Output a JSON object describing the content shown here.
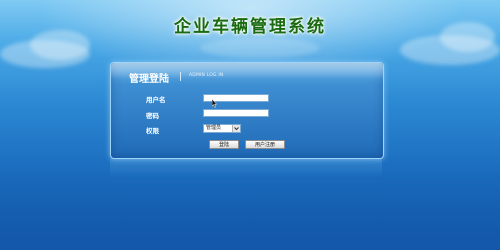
{
  "app": {
    "title": "企业车辆管理系统"
  },
  "login_panel": {
    "title": "管理登陆",
    "subtitle": "ADMIN LOG IN",
    "username_label": "用户名",
    "username_value": "",
    "password_label": "密码",
    "password_value": "",
    "role_label": "权限",
    "role_selected": "管理员",
    "login_button": "登陆",
    "register_button": "用户注册"
  },
  "icons": {
    "dropdown": "chevron-down-icon",
    "cursor": "mouse-pointer-icon"
  },
  "colors": {
    "title_text": "#1a6a12",
    "panel_top": "#6fb8ea",
    "panel_bottom": "#1f6ab7",
    "background_top": "#7fcaf3",
    "background_bottom": "#125aa8"
  }
}
